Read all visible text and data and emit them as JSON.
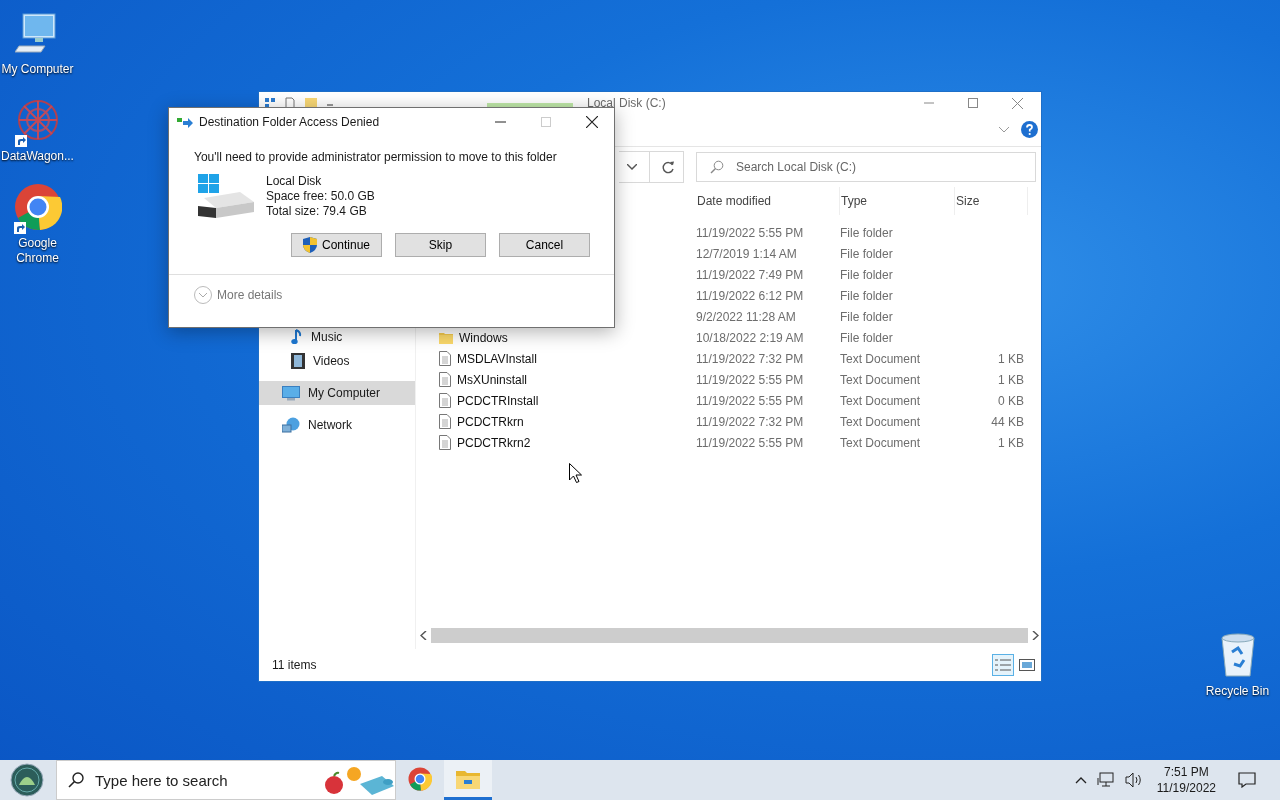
{
  "desktop_icons": [
    {
      "label": "My Computer",
      "kind": "computer",
      "shortcut": false
    },
    {
      "label": "DataWagon...",
      "kind": "app",
      "shortcut": true
    },
    {
      "label": "Google Chrome",
      "kind": "chrome",
      "shortcut": true
    }
  ],
  "recycle_bin": {
    "label": "Recycle Bin"
  },
  "explorer": {
    "title": "Local Disk (C:)",
    "search": {
      "placeholder": "Search Local Disk (C:)"
    },
    "nav_items": [
      {
        "label": "Music",
        "kind": "music",
        "selected": false
      },
      {
        "label": "Videos",
        "kind": "videos",
        "selected": false
      },
      {
        "label": "My Computer",
        "kind": "computer",
        "selected": true
      },
      {
        "label": "Network",
        "kind": "network",
        "selected": false
      }
    ],
    "columns": [
      "Date modified",
      "Type",
      "Size"
    ],
    "rows": [
      {
        "date": "11/19/2022 5:55 PM",
        "type": "File folder"
      },
      {
        "date": "12/7/2019 1:14 AM",
        "type": "File folder"
      },
      {
        "date": "11/19/2022 7:49 PM",
        "type": "File folder"
      },
      {
        "date": "11/19/2022 6:12 PM",
        "type": "File folder"
      },
      {
        "date": "9/2/2022 11:28 AM",
        "type": "File folder"
      },
      {
        "name": "Windows",
        "date": "10/18/2022 2:19 AM",
        "type": "File folder",
        "kind": "folder"
      },
      {
        "name": "MSDLAVInstall",
        "date": "11/19/2022 7:32 PM",
        "type": "Text Document",
        "size": "1 KB",
        "kind": "text"
      },
      {
        "name": "MsXUninstall",
        "date": "11/19/2022 5:55 PM",
        "type": "Text Document",
        "size": "1 KB",
        "kind": "text"
      },
      {
        "name": "PCDCTRInstall",
        "date": "11/19/2022 5:55 PM",
        "type": "Text Document",
        "size": "0 KB",
        "kind": "text"
      },
      {
        "name": "PCDCTRkrn",
        "date": "11/19/2022 7:32 PM",
        "type": "Text Document",
        "size": "44 KB",
        "kind": "text"
      },
      {
        "name": "PCDCTRkrn2",
        "date": "11/19/2022 5:55 PM",
        "type": "Text Document",
        "size": "1 KB",
        "kind": "text"
      }
    ],
    "status": "11 items",
    "view_buttons": [
      {
        "kind": "details",
        "selected": true
      },
      {
        "kind": "tiles",
        "selected": false
      }
    ]
  },
  "dialog": {
    "title": "Destination Folder Access Denied",
    "message": "You'll need to provide administrator permission to move to this folder",
    "drive_name": "Local Disk",
    "drive_lines": [
      "Space free: 50.0 GB",
      "Total size: 79.4 GB"
    ],
    "buttons": [
      {
        "label": "Continue",
        "kind": "shield"
      },
      {
        "label": "Skip",
        "kind": "plain"
      },
      {
        "label": "Cancel",
        "kind": "plain"
      }
    ],
    "more_details": "More details"
  },
  "taskbar": {
    "search": {
      "placeholder": "Type here to search"
    },
    "apps": [
      {
        "kind": "chrome",
        "active": false
      },
      {
        "kind": "explorer",
        "active": true
      }
    ],
    "time": "7:51 PM",
    "date": "11/19/2022"
  }
}
